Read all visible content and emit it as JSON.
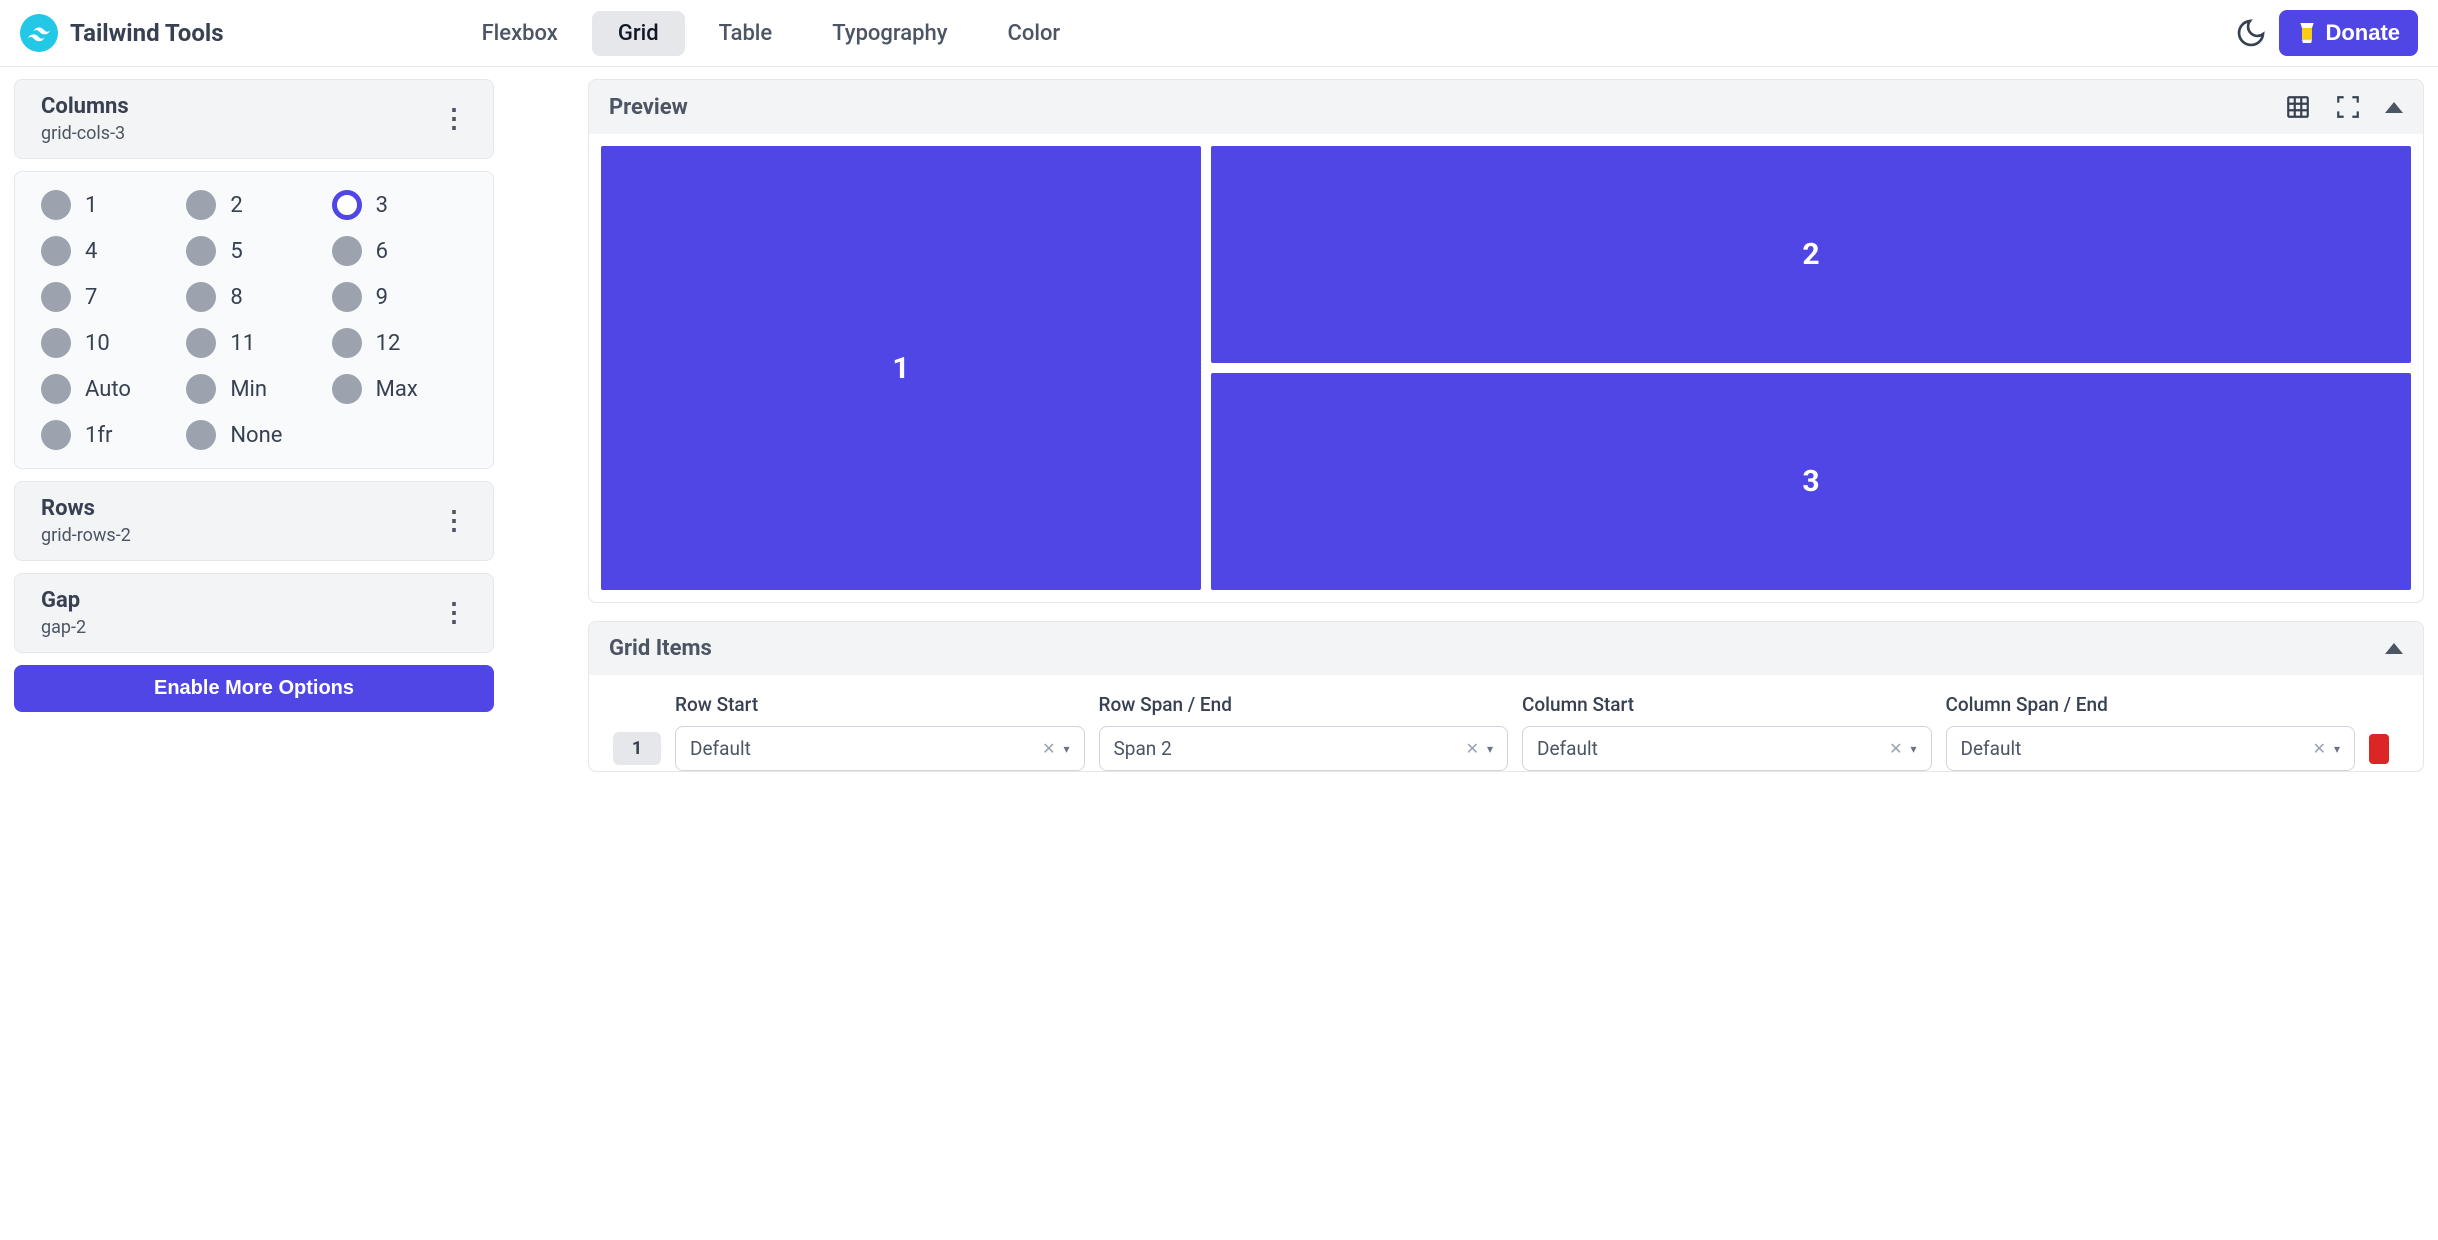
{
  "app": {
    "title": "Tailwind Tools"
  },
  "nav": {
    "items": [
      {
        "label": "Flexbox",
        "active": false
      },
      {
        "label": "Grid",
        "active": true
      },
      {
        "label": "Table",
        "active": false
      },
      {
        "label": "Typography",
        "active": false
      },
      {
        "label": "Color",
        "active": false
      }
    ],
    "donate_label": "Donate"
  },
  "sidebar": {
    "columns": {
      "title": "Columns",
      "sub": "grid-cols-3",
      "options": [
        {
          "label": "1"
        },
        {
          "label": "2"
        },
        {
          "label": "3",
          "selected": true
        },
        {
          "label": "4"
        },
        {
          "label": "5"
        },
        {
          "label": "6"
        },
        {
          "label": "7"
        },
        {
          "label": "8"
        },
        {
          "label": "9"
        },
        {
          "label": "10"
        },
        {
          "label": "11"
        },
        {
          "label": "12"
        },
        {
          "label": "Auto"
        },
        {
          "label": "Min"
        },
        {
          "label": "Max"
        },
        {
          "label": "1fr"
        },
        {
          "label": "None"
        }
      ]
    },
    "rows": {
      "title": "Rows",
      "sub": "grid-rows-2"
    },
    "gap": {
      "title": "Gap",
      "sub": "gap-2"
    },
    "enable_label": "Enable More Options"
  },
  "preview": {
    "title": "Preview",
    "cells": [
      {
        "label": "1"
      },
      {
        "label": "2"
      },
      {
        "label": "3"
      }
    ]
  },
  "grid_items": {
    "title": "Grid Items",
    "columns": [
      {
        "label": "Row Start"
      },
      {
        "label": "Row Span / End"
      },
      {
        "label": "Column Start"
      },
      {
        "label": "Column Span / End"
      }
    ],
    "rows": [
      {
        "num": "1",
        "row_start": "Default",
        "row_span": "Span 2",
        "col_start": "Default",
        "col_span": "Default"
      }
    ]
  }
}
